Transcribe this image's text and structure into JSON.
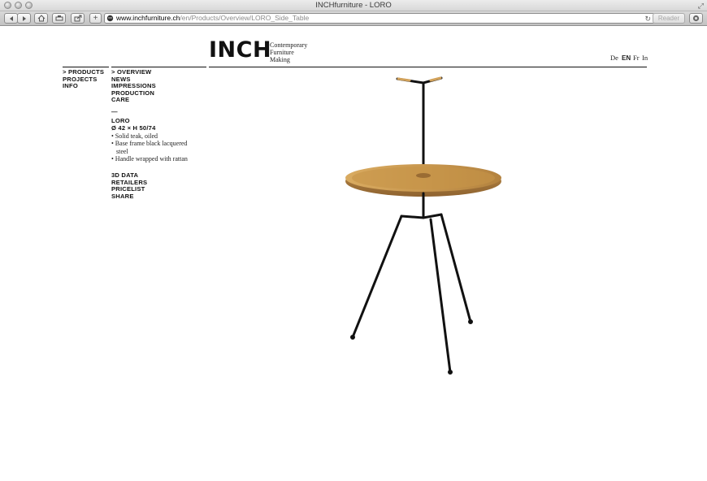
{
  "window": {
    "title": "INCHfurniture - LORO"
  },
  "toolbar": {
    "url_domain": "www.inchfurniture.ch",
    "url_path": "/en/Products/Overview/LORO_Side_Table",
    "reader_label": "Reader"
  },
  "brand": {
    "logo_text": "INCH",
    "tagline": [
      "Contemporary",
      "Furniture",
      "Making"
    ]
  },
  "languages": [
    {
      "label": "De",
      "active": false
    },
    {
      "label": "EN",
      "active": true
    },
    {
      "label": "Fr",
      "active": false
    },
    {
      "label": "In",
      "active": false
    }
  ],
  "main_nav": [
    "> PRODUCTS",
    "PROJECTS",
    "INFO"
  ],
  "sub_nav": [
    "> OVERVIEW",
    "NEWS",
    "IMPRESSIONS",
    "PRODUCTION",
    "CARE"
  ],
  "product": {
    "dash": "—",
    "name": "LORO",
    "dimensions": "Ø 42 × H 50/74",
    "features": [
      "• Solid teak, oiled",
      "• Base frame black lacquered",
      "steel",
      "• Handle wrapped with rattan"
    ]
  },
  "links": [
    "3D DATA",
    "RETAILERS",
    "PRICELIST",
    "SHARE"
  ],
  "colors": {
    "teak": "#c99a52",
    "frame": "#111111"
  }
}
